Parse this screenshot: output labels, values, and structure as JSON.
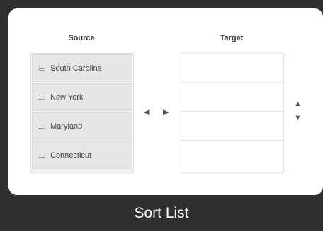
{
  "source": {
    "title": "Source",
    "items": [
      {
        "label": "South Carolina"
      },
      {
        "label": "New York"
      },
      {
        "label": "Maryland"
      },
      {
        "label": "Connecticut"
      }
    ]
  },
  "target": {
    "title": "Target",
    "slots": [
      "",
      "",
      "",
      ""
    ]
  },
  "controls": {
    "move_left": "◀",
    "move_right": "▶",
    "move_up": "▲",
    "move_down": "▼"
  },
  "footer": {
    "caption": "Sort List"
  }
}
